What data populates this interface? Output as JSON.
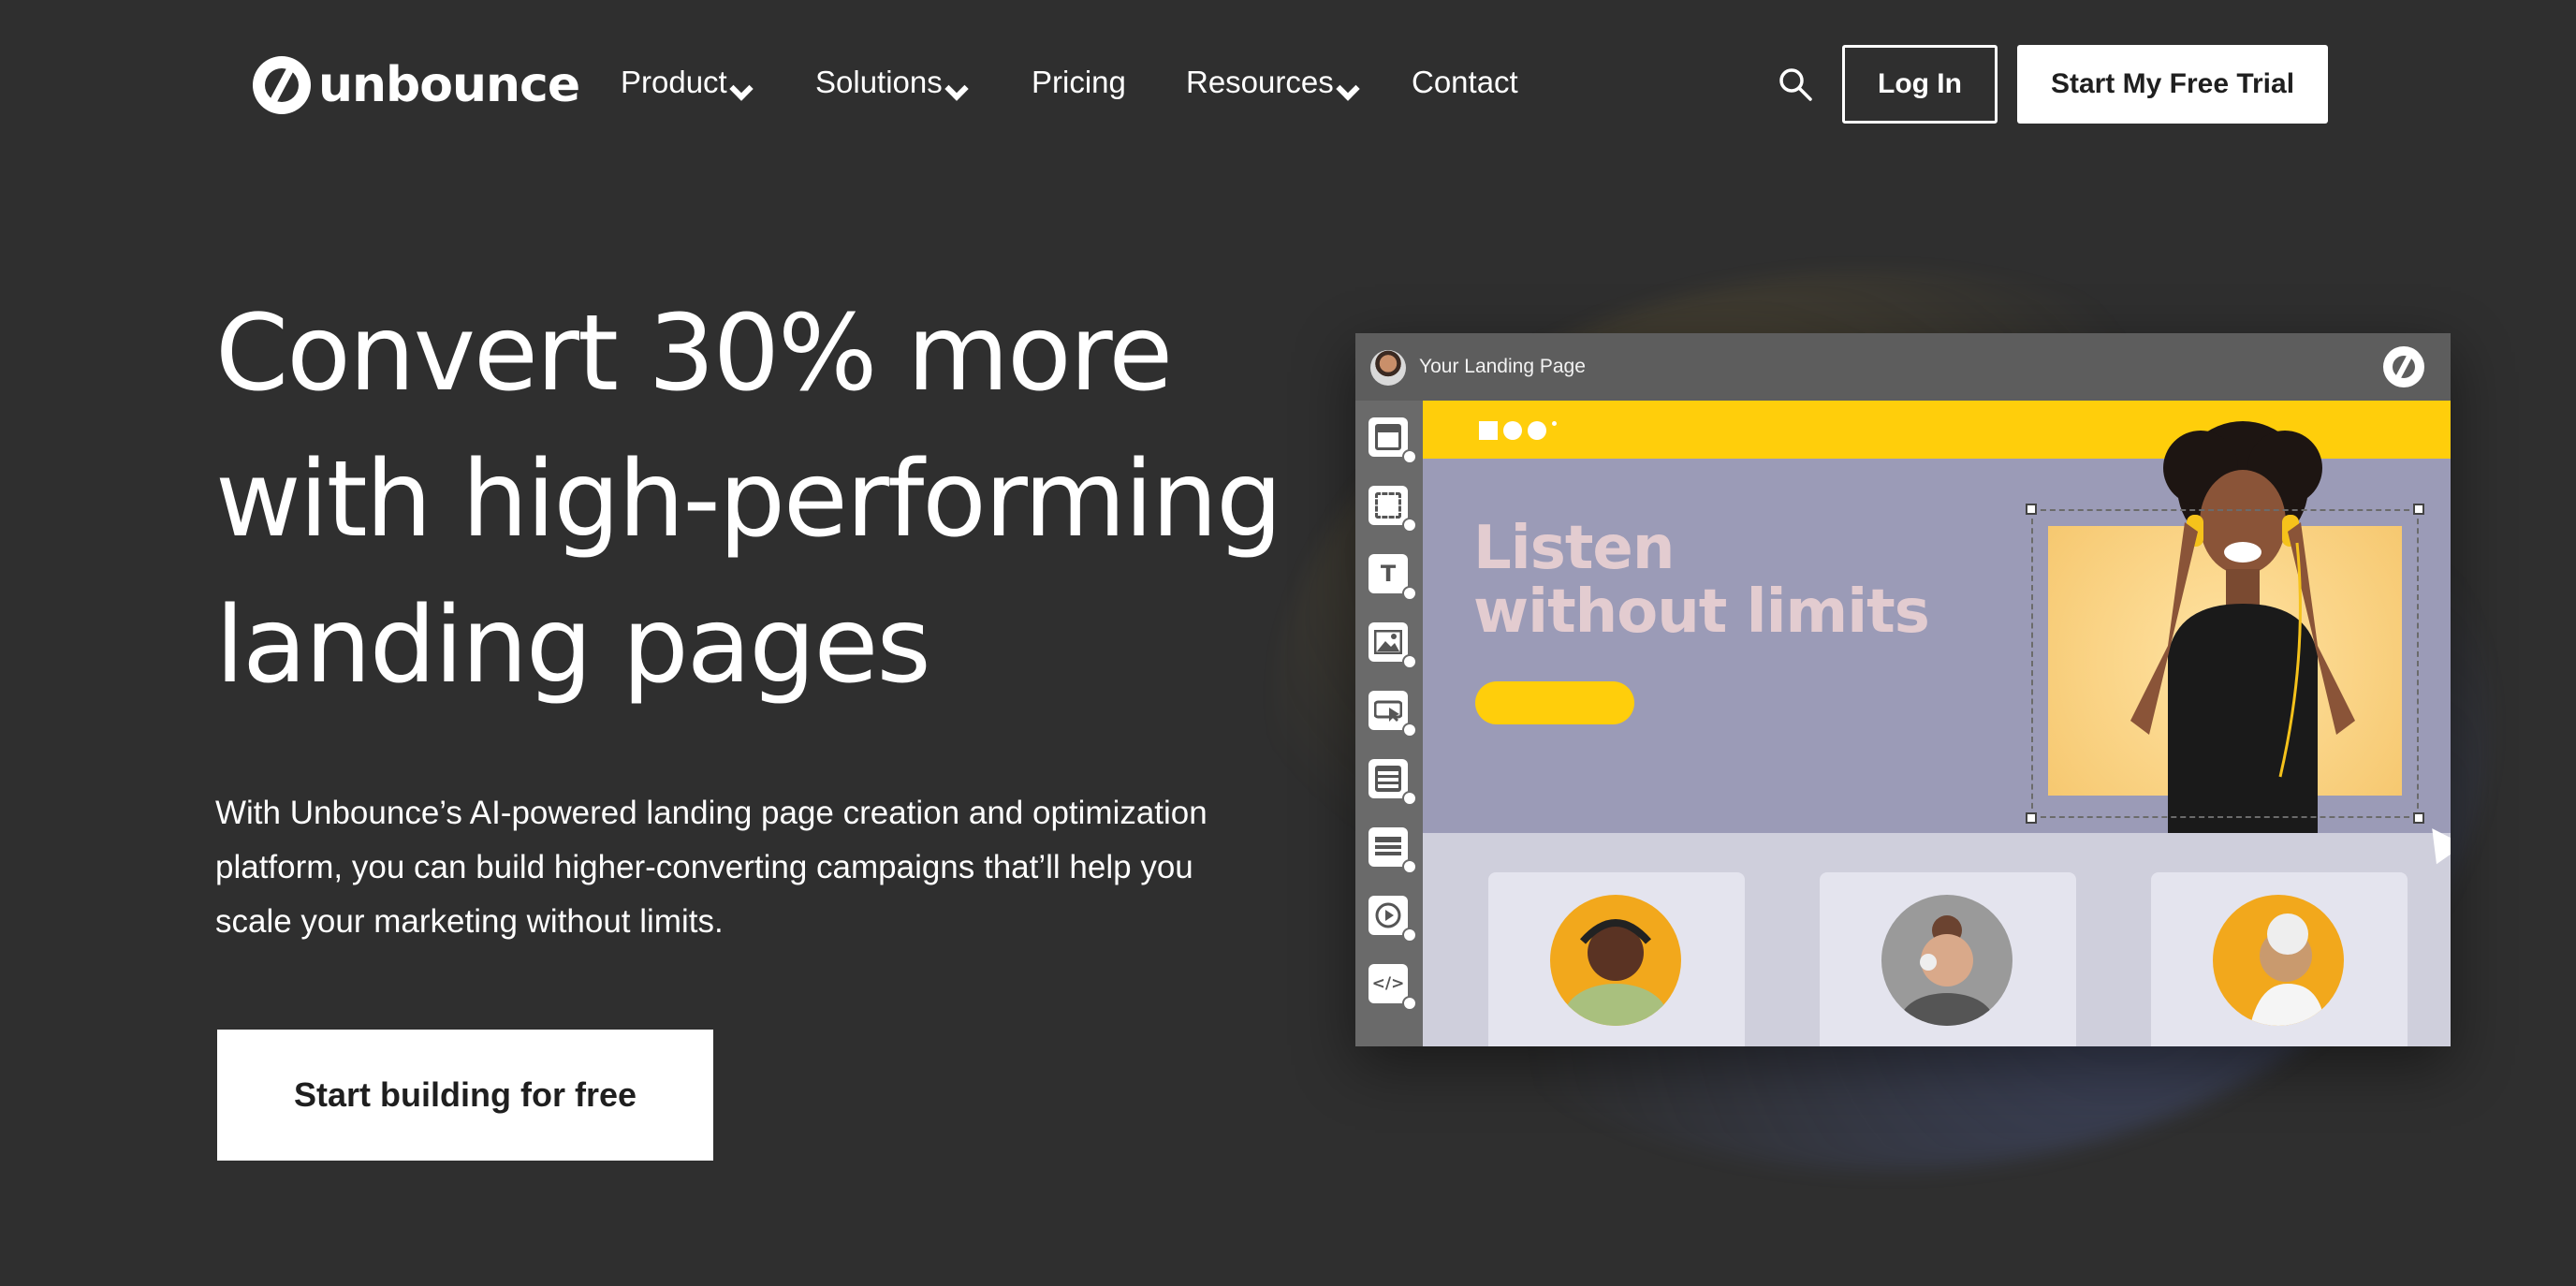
{
  "nav": {
    "logo_text": "unbounce",
    "items": [
      {
        "label": "Product",
        "has_dropdown": true
      },
      {
        "label": "Solutions",
        "has_dropdown": true
      },
      {
        "label": "Pricing",
        "has_dropdown": false
      },
      {
        "label": "Resources",
        "has_dropdown": true
      },
      {
        "label": "Contact",
        "has_dropdown": false
      }
    ],
    "search_icon": "search-icon",
    "login_label": "Log In",
    "trial_label": "Start My Free Trial"
  },
  "hero": {
    "title_lines": [
      "Convert 30% more",
      "with high-performing",
      "landing pages"
    ],
    "subtitle": "With Unbounce’s AI-powered landing page creation and optimization platform, you can build higher-converting campaigns that’ll help you scale your marketing without limits.",
    "cta_label": "Start building for free"
  },
  "mockup": {
    "window_title": "Your Landing Page",
    "headline_lines": [
      "Listen",
      "without limits"
    ],
    "tools": [
      "section-tool-icon",
      "box-tool-icon",
      "text-tool-icon",
      "image-tool-icon",
      "button-tool-icon",
      "form-tool-icon",
      "list-tool-icon",
      "video-tool-icon",
      "code-tool-icon"
    ],
    "tool_glyphs": {
      "text": "T",
      "code": "</>"
    }
  },
  "colors": {
    "background": "#2f2f2f",
    "accent_yellow": "#ffce0b",
    "mock_lavender": "#9b9bb7",
    "mock_headline": "#e3ccd0",
    "white": "#ffffff"
  }
}
